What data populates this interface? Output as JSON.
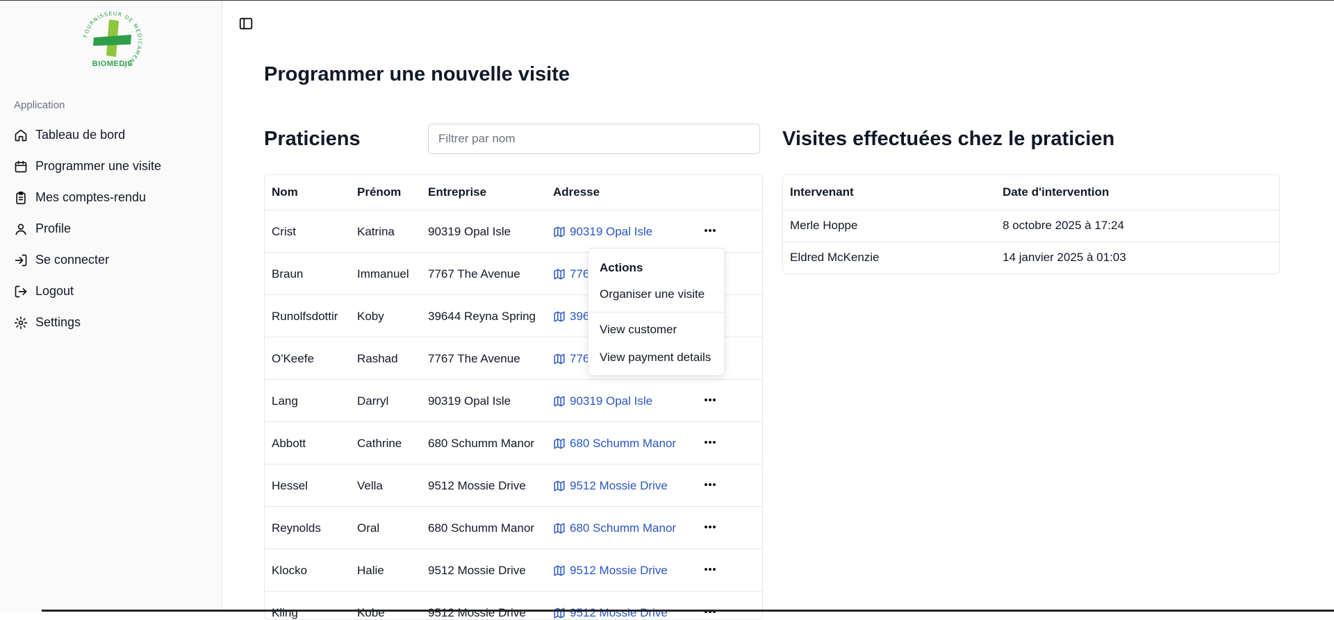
{
  "brand": {
    "logo_text": "BIOMEDIS",
    "logo_ring_text": "FOURNISSEUR DE MÉDICAMENTS",
    "color": "#2e9e49"
  },
  "sidebar": {
    "group_label": "Application",
    "items": [
      {
        "label": "Tableau de bord",
        "icon": "home-icon"
      },
      {
        "label": "Programmer une visite",
        "icon": "calendar-icon"
      },
      {
        "label": "Mes comptes-rendu",
        "icon": "clipboard-icon"
      },
      {
        "label": "Profile",
        "icon": "user-icon"
      },
      {
        "label": "Se connecter",
        "icon": "login-icon"
      },
      {
        "label": "Logout",
        "icon": "logout-icon"
      },
      {
        "label": "Settings",
        "icon": "gear-icon"
      }
    ]
  },
  "main": {
    "title": "Programmer une nouvelle visite",
    "practitioners": {
      "title": "Praticiens",
      "filter_placeholder": "Filtrer par nom",
      "columns": [
        "Nom",
        "Prénom",
        "Entreprise",
        "Adresse"
      ],
      "rows": [
        {
          "nom": "Crist",
          "prenom": "Katrina",
          "entreprise": "90319 Opal Isle",
          "adresse": "90319 Opal Isle"
        },
        {
          "nom": "Braun",
          "prenom": "Immanuel",
          "entreprise": "7767 The Avenue",
          "adresse": "7767 The Avenue"
        },
        {
          "nom": "Runolfsdottir",
          "prenom": "Koby",
          "entreprise": "39644 Reyna Spring",
          "adresse": "39644 Reyna Spring"
        },
        {
          "nom": "O'Keefe",
          "prenom": "Rashad",
          "entreprise": "7767 The Avenue",
          "adresse": "7767 The Avenue"
        },
        {
          "nom": "Lang",
          "prenom": "Darryl",
          "entreprise": "90319 Opal Isle",
          "adresse": "90319 Opal Isle"
        },
        {
          "nom": "Abbott",
          "prenom": "Cathrine",
          "entreprise": "680 Schumm Manor",
          "adresse": "680 Schumm Manor"
        },
        {
          "nom": "Hessel",
          "prenom": "Vella",
          "entreprise": "9512 Mossie Drive",
          "adresse": "9512 Mossie Drive"
        },
        {
          "nom": "Reynolds",
          "prenom": "Oral",
          "entreprise": "680 Schumm Manor",
          "adresse": "680 Schumm Manor"
        },
        {
          "nom": "Klocko",
          "prenom": "Halie",
          "entreprise": "9512 Mossie Drive",
          "adresse": "9512 Mossie Drive"
        },
        {
          "nom": "Kling",
          "prenom": "Kobe",
          "entreprise": "9512 Mossie Drive",
          "adresse": "9512 Mossie Drive"
        }
      ]
    },
    "actions_menu": {
      "label": "Actions",
      "items": [
        "Organiser une visite",
        "View customer",
        "View payment details"
      ]
    },
    "visits": {
      "title": "Visites effectuées chez le praticien",
      "columns": [
        "Intervenant",
        "Date d'intervention"
      ],
      "rows": [
        {
          "intervenant": "Merle Hoppe",
          "date": "8 octobre 2025 à 17:24"
        },
        {
          "intervenant": "Eldred McKenzie",
          "date": "14 janvier 2025 à 01:03"
        }
      ]
    }
  }
}
